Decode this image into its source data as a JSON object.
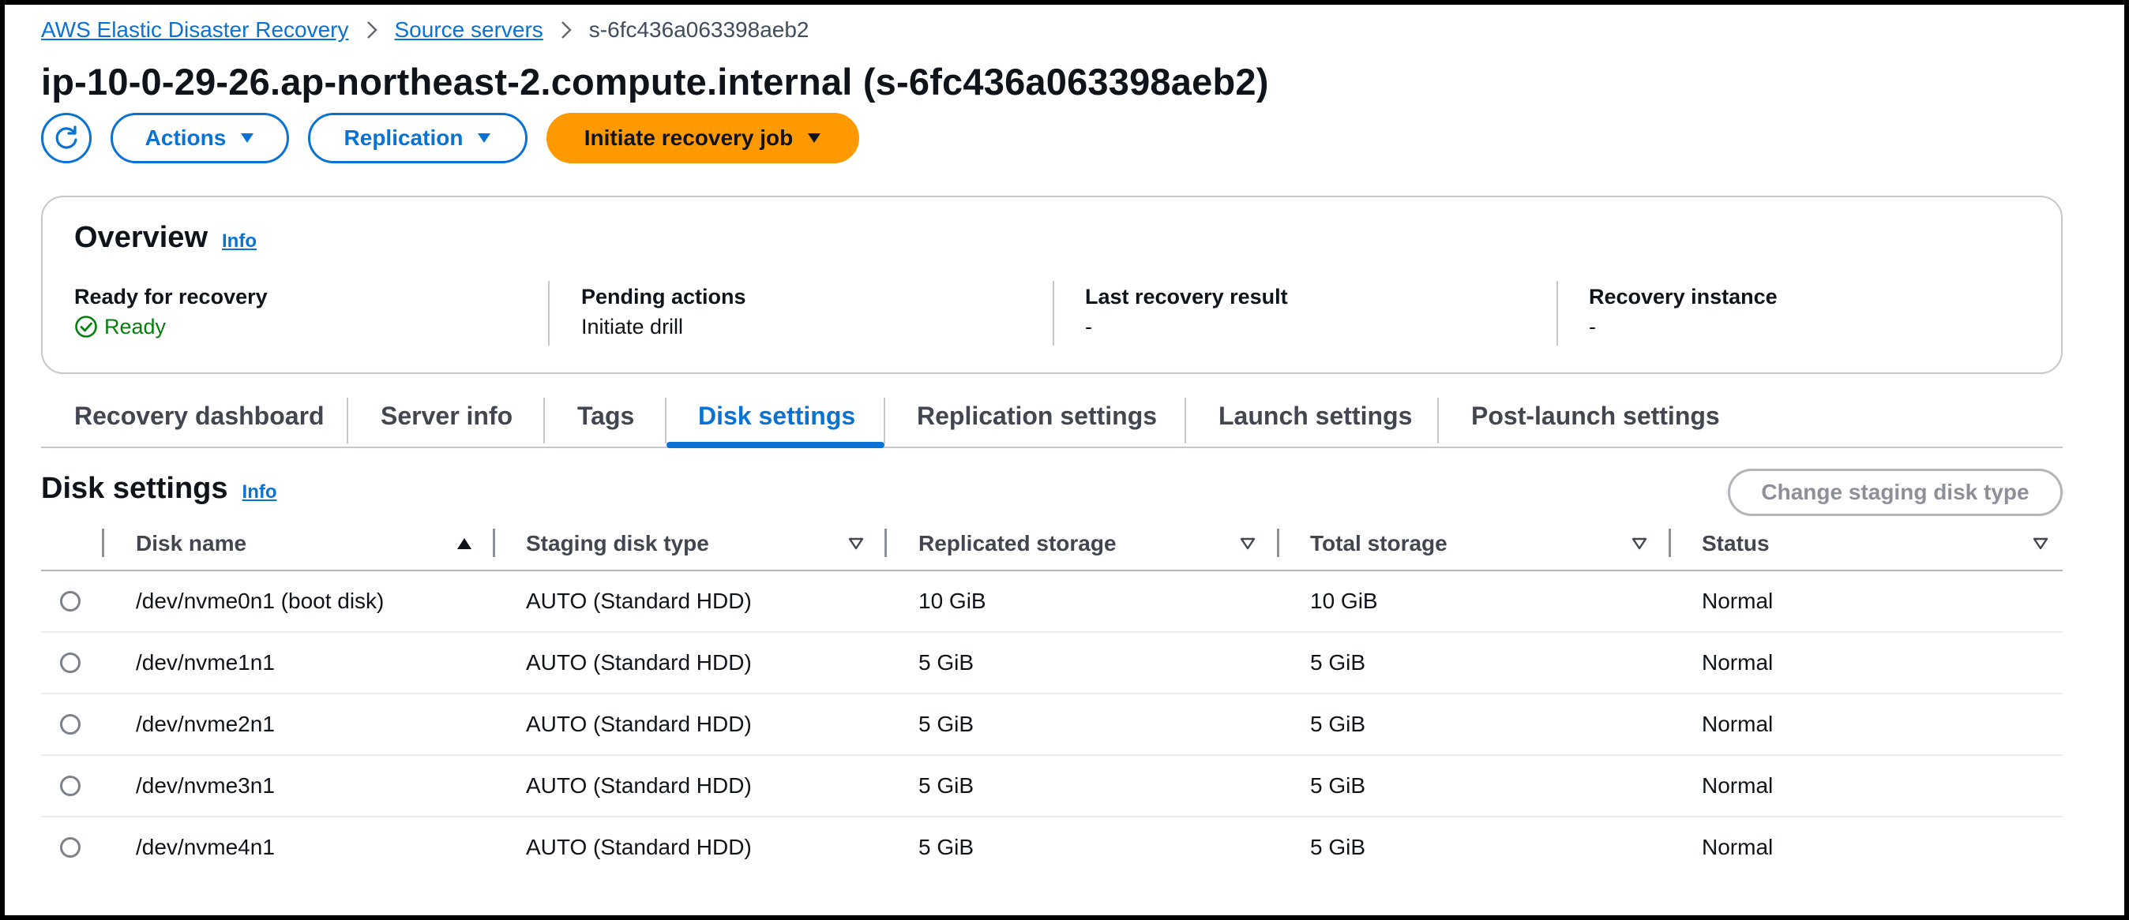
{
  "breadcrumb": {
    "items": [
      "AWS Elastic Disaster Recovery",
      "Source servers"
    ],
    "current": "s-6fc436a063398aeb2"
  },
  "page": {
    "title": "ip-10-0-29-26.ap-northeast-2.compute.internal (s-6fc436a063398aeb2)"
  },
  "toolbar": {
    "refresh_icon": "refresh-icon",
    "actions_label": "Actions",
    "replication_label": "Replication",
    "initiate_label": "Initiate recovery job"
  },
  "overview": {
    "title": "Overview",
    "info": "Info",
    "fields": [
      {
        "label": "Ready for recovery",
        "value": "Ready",
        "icon": "check-circle-icon",
        "color": "#037f0c"
      },
      {
        "label": "Pending actions",
        "value": "Initiate drill"
      },
      {
        "label": "Last recovery result",
        "value": "-"
      },
      {
        "label": "Recovery instance",
        "value": "-"
      }
    ]
  },
  "tabs": [
    "Recovery dashboard",
    "Server info",
    "Tags",
    "Disk settings",
    "Replication settings",
    "Launch settings",
    "Post-launch settings"
  ],
  "active_tab": "Disk settings",
  "disk_settings": {
    "title": "Disk settings",
    "info": "Info",
    "change_button": "Change staging disk type",
    "columns": [
      "Disk name",
      "Staging disk type",
      "Replicated storage",
      "Total storage",
      "Status"
    ],
    "rows": [
      {
        "name": "/dev/nvme0n1 (boot disk)",
        "type": "AUTO (Standard HDD)",
        "replicated": "10 GiB",
        "total": "10 GiB",
        "status": "Normal"
      },
      {
        "name": "/dev/nvme1n1",
        "type": "AUTO (Standard HDD)",
        "replicated": "5 GiB",
        "total": "5 GiB",
        "status": "Normal"
      },
      {
        "name": "/dev/nvme2n1",
        "type": "AUTO (Standard HDD)",
        "replicated": "5 GiB",
        "total": "5 GiB",
        "status": "Normal"
      },
      {
        "name": "/dev/nvme3n1",
        "type": "AUTO (Standard HDD)",
        "replicated": "5 GiB",
        "total": "5 GiB",
        "status": "Normal"
      },
      {
        "name": "/dev/nvme4n1",
        "type": "AUTO (Standard HDD)",
        "replicated": "5 GiB",
        "total": "5 GiB",
        "status": "Normal"
      }
    ]
  },
  "colors": {
    "link": "#0972d3",
    "primary_button": "#ff9900",
    "success": "#037f0c"
  }
}
